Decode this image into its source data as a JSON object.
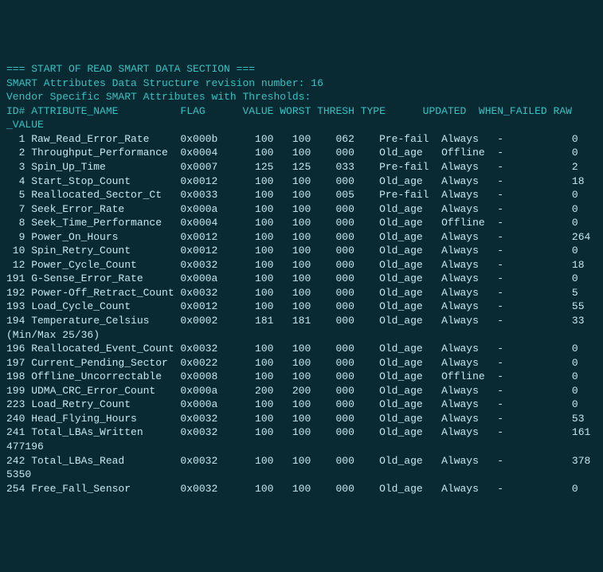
{
  "header": {
    "section_title": "=== START OF READ SMART DATA SECTION ===",
    "revision_line": "SMART Attributes Data Structure revision number: 16",
    "vendor_line": "Vendor Specific SMART Attributes with Thresholds:"
  },
  "columns": {
    "id": "ID#",
    "attr": "ATTRIBUTE_NAME",
    "flag": "FLAG",
    "value": "VALUE",
    "worst": "WORST",
    "thresh": "THRESH",
    "type": "TYPE",
    "updated": "UPDATED",
    "when_failed": "WHEN_FAILED",
    "raw": "RAW",
    "raw_value_cont": "_VALUE"
  },
  "rows": [
    {
      "id": "1",
      "attr": "Raw_Read_Error_Rate",
      "flag": "0x000b",
      "value": "100",
      "worst": "100",
      "thresh": "062",
      "type": "Pre-fail",
      "updated": "Always",
      "when_failed": "-",
      "raw": "0"
    },
    {
      "id": "2",
      "attr": "Throughput_Performance",
      "flag": "0x0004",
      "value": "100",
      "worst": "100",
      "thresh": "000",
      "type": "Old_age",
      "updated": "Offline",
      "when_failed": "-",
      "raw": "0"
    },
    {
      "id": "3",
      "attr": "Spin_Up_Time",
      "flag": "0x0007",
      "value": "125",
      "worst": "125",
      "thresh": "033",
      "type": "Pre-fail",
      "updated": "Always",
      "when_failed": "-",
      "raw": "2"
    },
    {
      "id": "4",
      "attr": "Start_Stop_Count",
      "flag": "0x0012",
      "value": "100",
      "worst": "100",
      "thresh": "000",
      "type": "Old_age",
      "updated": "Always",
      "when_failed": "-",
      "raw": "18"
    },
    {
      "id": "5",
      "attr": "Reallocated_Sector_Ct",
      "flag": "0x0033",
      "value": "100",
      "worst": "100",
      "thresh": "005",
      "type": "Pre-fail",
      "updated": "Always",
      "when_failed": "-",
      "raw": "0"
    },
    {
      "id": "7",
      "attr": "Seek_Error_Rate",
      "flag": "0x000a",
      "value": "100",
      "worst": "100",
      "thresh": "000",
      "type": "Old_age",
      "updated": "Always",
      "when_failed": "-",
      "raw": "0"
    },
    {
      "id": "8",
      "attr": "Seek_Time_Performance",
      "flag": "0x0004",
      "value": "100",
      "worst": "100",
      "thresh": "000",
      "type": "Old_age",
      "updated": "Offline",
      "when_failed": "-",
      "raw": "0"
    },
    {
      "id": "9",
      "attr": "Power_On_Hours",
      "flag": "0x0012",
      "value": "100",
      "worst": "100",
      "thresh": "000",
      "type": "Old_age",
      "updated": "Always",
      "when_failed": "-",
      "raw": "264"
    },
    {
      "id": "10",
      "attr": "Spin_Retry_Count",
      "flag": "0x0012",
      "value": "100",
      "worst": "100",
      "thresh": "000",
      "type": "Old_age",
      "updated": "Always",
      "when_failed": "-",
      "raw": "0"
    },
    {
      "id": "12",
      "attr": "Power_Cycle_Count",
      "flag": "0x0032",
      "value": "100",
      "worst": "100",
      "thresh": "000",
      "type": "Old_age",
      "updated": "Always",
      "when_failed": "-",
      "raw": "18"
    },
    {
      "id": "191",
      "attr": "G-Sense_Error_Rate",
      "flag": "0x000a",
      "value": "100",
      "worst": "100",
      "thresh": "000",
      "type": "Old_age",
      "updated": "Always",
      "when_failed": "-",
      "raw": "0"
    },
    {
      "id": "192",
      "attr": "Power-Off_Retract_Count",
      "flag": "0x0032",
      "value": "100",
      "worst": "100",
      "thresh": "000",
      "type": "Old_age",
      "updated": "Always",
      "when_failed": "-",
      "raw": "5"
    },
    {
      "id": "193",
      "attr": "Load_Cycle_Count",
      "flag": "0x0012",
      "value": "100",
      "worst": "100",
      "thresh": "000",
      "type": "Old_age",
      "updated": "Always",
      "when_failed": "-",
      "raw": "55"
    },
    {
      "id": "194",
      "attr": "Temperature_Celsius",
      "flag": "0x0002",
      "value": "181",
      "worst": "181",
      "thresh": "000",
      "type": "Old_age",
      "updated": "Always",
      "when_failed": "-",
      "raw": "33",
      "extra": "(Min/Max 25/36)"
    },
    {
      "id": "196",
      "attr": "Reallocated_Event_Count",
      "flag": "0x0032",
      "value": "100",
      "worst": "100",
      "thresh": "000",
      "type": "Old_age",
      "updated": "Always",
      "when_failed": "-",
      "raw": "0"
    },
    {
      "id": "197",
      "attr": "Current_Pending_Sector",
      "flag": "0x0022",
      "value": "100",
      "worst": "100",
      "thresh": "000",
      "type": "Old_age",
      "updated": "Always",
      "when_failed": "-",
      "raw": "0"
    },
    {
      "id": "198",
      "attr": "Offline_Uncorrectable",
      "flag": "0x0008",
      "value": "100",
      "worst": "100",
      "thresh": "000",
      "type": "Old_age",
      "updated": "Offline",
      "when_failed": "-",
      "raw": "0"
    },
    {
      "id": "199",
      "attr": "UDMA_CRC_Error_Count",
      "flag": "0x000a",
      "value": "200",
      "worst": "200",
      "thresh": "000",
      "type": "Old_age",
      "updated": "Always",
      "when_failed": "-",
      "raw": "0"
    },
    {
      "id": "223",
      "attr": "Load_Retry_Count",
      "flag": "0x000a",
      "value": "100",
      "worst": "100",
      "thresh": "000",
      "type": "Old_age",
      "updated": "Always",
      "when_failed": "-",
      "raw": "0"
    },
    {
      "id": "240",
      "attr": "Head_Flying_Hours",
      "flag": "0x0032",
      "value": "100",
      "worst": "100",
      "thresh": "000",
      "type": "Old_age",
      "updated": "Always",
      "when_failed": "-",
      "raw": "53"
    },
    {
      "id": "241",
      "attr": "Total_LBAs_Written",
      "flag": "0x0032",
      "value": "100",
      "worst": "100",
      "thresh": "000",
      "type": "Old_age",
      "updated": "Always",
      "when_failed": "-",
      "raw": "161",
      "extra": "477196"
    },
    {
      "id": "242",
      "attr": "Total_LBAs_Read",
      "flag": "0x0032",
      "value": "100",
      "worst": "100",
      "thresh": "000",
      "type": "Old_age",
      "updated": "Always",
      "when_failed": "-",
      "raw": "378",
      "extra": "5350"
    },
    {
      "id": "254",
      "attr": "Free_Fall_Sensor",
      "flag": "0x0032",
      "value": "100",
      "worst": "100",
      "thresh": "000",
      "type": "Old_age",
      "updated": "Always",
      "when_failed": "-",
      "raw": "0"
    }
  ]
}
